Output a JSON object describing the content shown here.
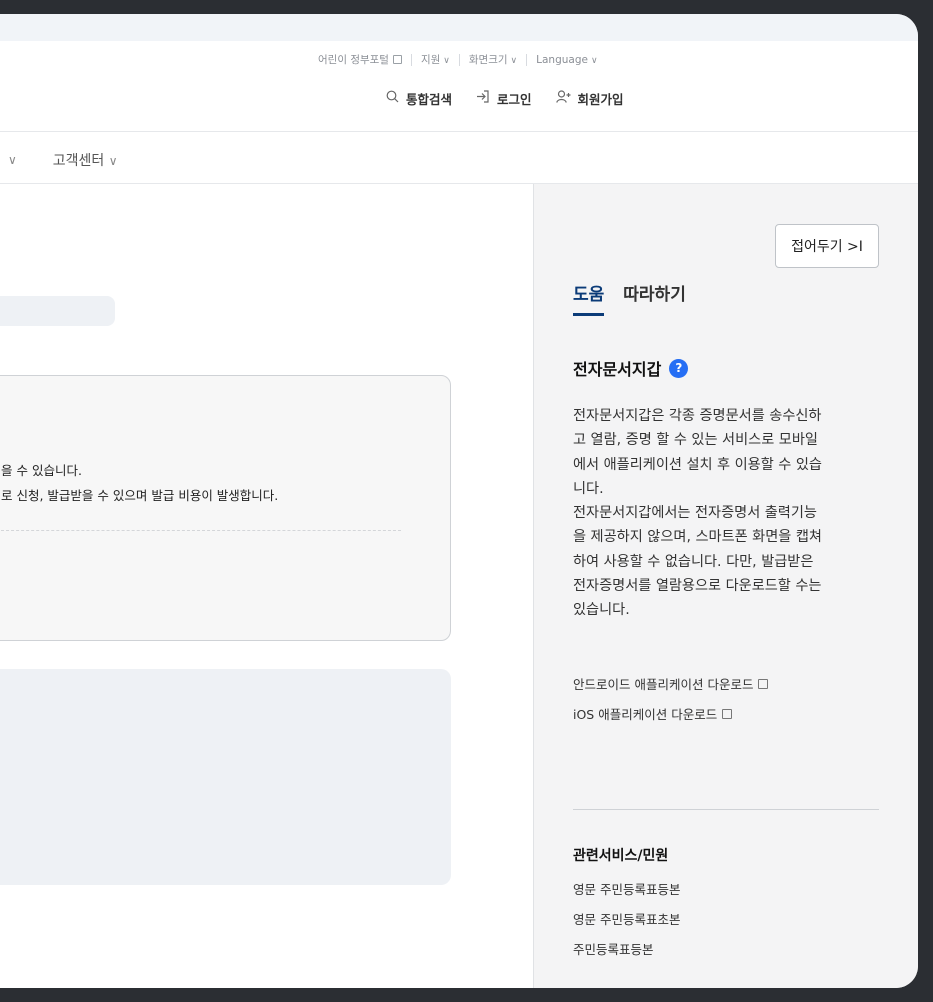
{
  "utility_links": [
    {
      "label": "어린이 정부포털",
      "icon": "external-link-icon"
    },
    {
      "label": "지원",
      "icon": "chevron-down-icon"
    },
    {
      "label": "화면크기",
      "icon": "chevron-down-icon"
    },
    {
      "label": "Language",
      "icon": "chevron-down-icon"
    }
  ],
  "header_actions": {
    "search": {
      "icon": "search-icon",
      "label": "통합검색"
    },
    "login": {
      "icon": "login-icon",
      "label": "로그인"
    },
    "signup": {
      "icon": "user-add-icon",
      "label": "회원가입"
    }
  },
  "nav": {
    "customer_center": "고객센터"
  },
  "main": {
    "notice_line1": "을 수 있습니다.",
    "notice_line2": "로 신청, 발급받을 수 있으며 발급 비용이 발생합니다."
  },
  "help_panel": {
    "fold_button": "접어두기 >I",
    "tabs": [
      "도움",
      "따라하기"
    ],
    "active_tab": "도움",
    "title": "전자문서지갑",
    "description_lines": [
      "전자문서지갑은 각종 증명문서를 송수신하",
      "고 열람, 증명 할 수 있는 서비스로 모바일",
      "에서 애플리케이션 설치 후 이용할 수 있습",
      "니다.",
      "전자문서지갑에서는 전자증명서 출력기능",
      "을 제공하지 않으며, 스마트폰 화면을 캡쳐",
      "하여 사용할 수 없습니다. 다만, 발급받은",
      "전자증명서를 열람용으로 다운로드할 수는",
      "있습니다."
    ],
    "download_links": [
      "안드로이드 애플리케이션 다운로드",
      "iOS 애플리케이션 다운로드"
    ],
    "related_title": "관련서비스/민원",
    "related_items": [
      "영문 주민등록표등본",
      "영문 주민등록표초본",
      "주민등록표등본"
    ]
  },
  "colors": {
    "accent": "#0b3b78",
    "help_badge": "#256ef4",
    "panel_bg": "#f4f4f5"
  }
}
